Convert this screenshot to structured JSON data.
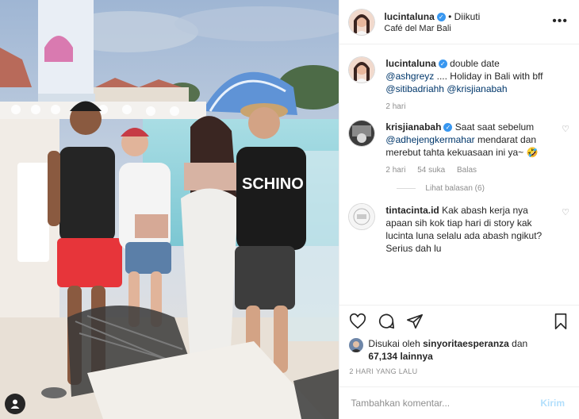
{
  "post": {
    "author": "lucintaluna",
    "follow_status": "• Diikuti",
    "location": "Café del Mar Bali"
  },
  "comments": [
    {
      "user": "lucintaluna",
      "segments": [
        "double date ",
        "@ashgreyz",
        " .... Holiday in Bali with bff ",
        "@sitibadriahh",
        " ",
        "@krisjianabah"
      ],
      "time": "2 hari"
    },
    {
      "user": "krisjianabah",
      "segments": [
        "Saat saat sebelum ",
        "@adhejengkermahar",
        " mendarat dan merebut tahta kekuasaan ini ya~ 🤣"
      ],
      "time": "2 hari",
      "likes": "54 suka",
      "reply": "Balas",
      "view_replies": "Lihat balasan (6)"
    },
    {
      "user": "tintacinta.id",
      "segments": [
        "Kak abash kerja nya apaan sih kok tiap hari di story kak lucinta luna selalu ada abash ngikut? Serius dah lu"
      ]
    }
  ],
  "likes": {
    "prefix": "Disukai oleh ",
    "user": "sinyoritaesperanza",
    "suffix": " dan",
    "count": "67,134 lainnya"
  },
  "time_ago": "2 HARI YANG LALU",
  "add_comment": {
    "placeholder": "Tambahkan komentar...",
    "post_label": "Kirim"
  },
  "icons": {
    "like": "heart-icon",
    "comment": "comment-icon",
    "share": "share-icon",
    "save": "bookmark-icon",
    "more": "more-icon",
    "tagged": "user-icon"
  },
  "colors": {
    "verified": "#3897f0",
    "link": "#00376b",
    "muted": "#8e8e8e",
    "post_button": "#b2dffc"
  }
}
